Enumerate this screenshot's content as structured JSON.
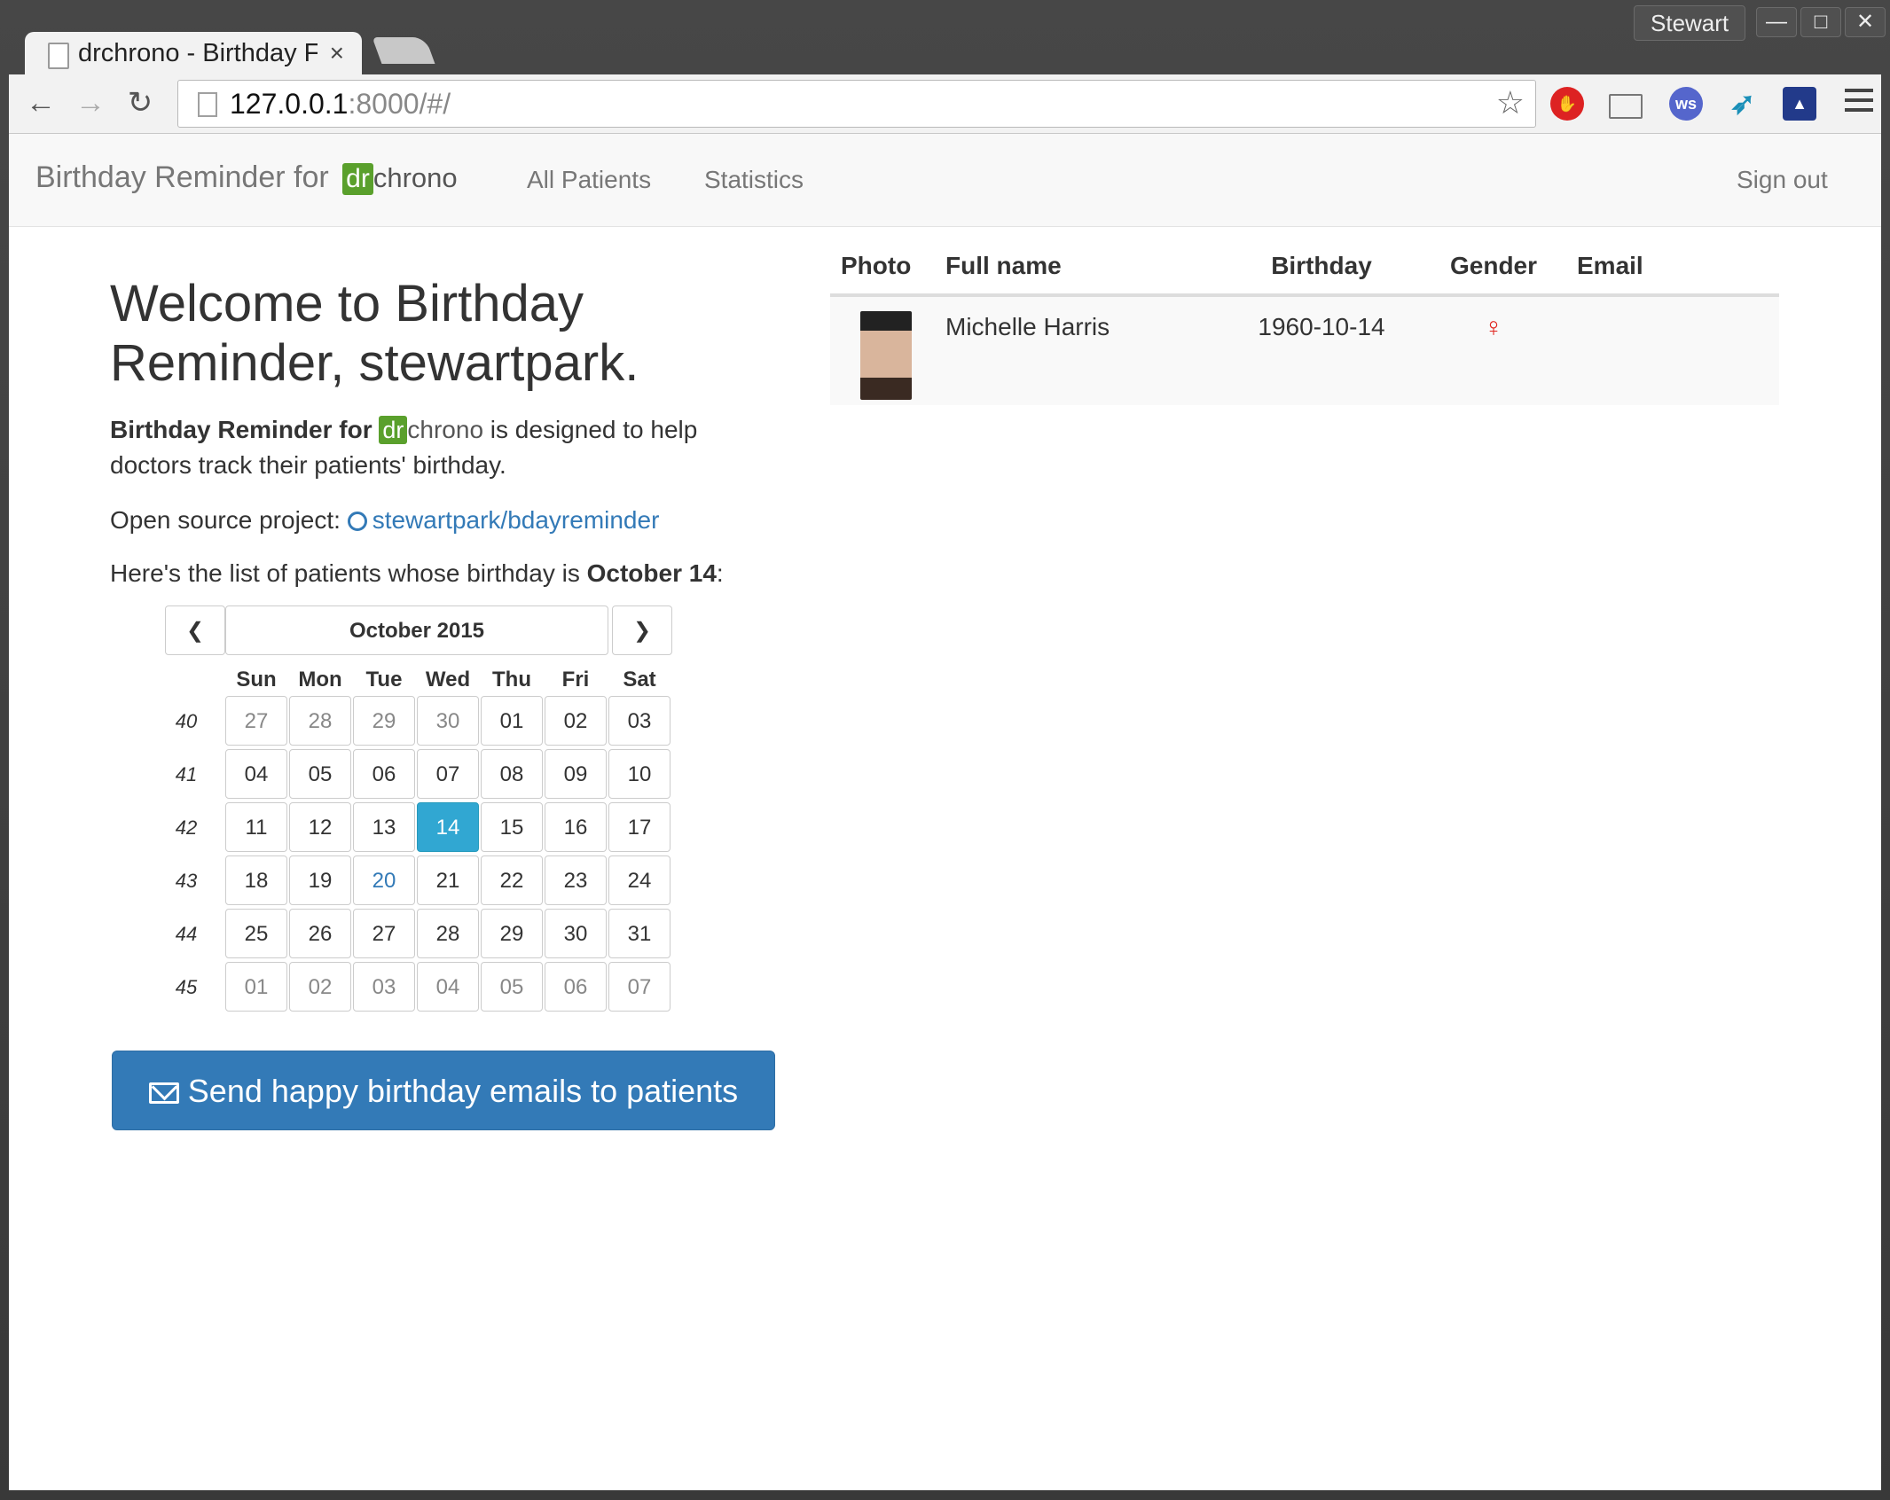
{
  "browser": {
    "tab_title": "drchrono - Birthday F",
    "tab_close": "×",
    "url_host": "127.0.0.1",
    "url_rest": ":8000/#/",
    "profile": "Stewart",
    "extensions": [
      "adblock-icon",
      "cast-icon",
      "ws-icon",
      "bird-icon",
      "stats-icon"
    ]
  },
  "navbar": {
    "brand_text": "Birthday Reminder for",
    "brand_dr": "dr",
    "brand_chrono": "chrono",
    "links": [
      "All Patients",
      "Statistics"
    ],
    "sign_out": "Sign out"
  },
  "main": {
    "welcome": "Welcome to Birthday Reminder, stewartpark.",
    "intro_bold": "Birthday Reminder for",
    "intro_dr": "dr",
    "intro_chrono": "chrono",
    "intro_rest": " is designed to help doctors track their patients' birthday.",
    "oss_label": "Open source project: ",
    "oss_link": "stewartpark/bdayreminder",
    "list_prefix": "Here's the list of patients whose birthday is ",
    "list_date": "October 14",
    "list_suffix": ":",
    "send_button": "Send happy birthday emails to patients"
  },
  "calendar": {
    "title": "October 2015",
    "weekdays": [
      "Sun",
      "Mon",
      "Tue",
      "Wed",
      "Thu",
      "Fri",
      "Sat"
    ],
    "weeks": [
      {
        "num": "40",
        "days": [
          "27",
          "28",
          "29",
          "30",
          "01",
          "02",
          "03"
        ]
      },
      {
        "num": "41",
        "days": [
          "04",
          "05",
          "06",
          "07",
          "08",
          "09",
          "10"
        ]
      },
      {
        "num": "42",
        "days": [
          "11",
          "12",
          "13",
          "14",
          "15",
          "16",
          "17"
        ]
      },
      {
        "num": "43",
        "days": [
          "18",
          "19",
          "20",
          "21",
          "22",
          "23",
          "24"
        ]
      },
      {
        "num": "44",
        "days": [
          "25",
          "26",
          "27",
          "28",
          "29",
          "30",
          "31"
        ]
      },
      {
        "num": "45",
        "days": [
          "01",
          "02",
          "03",
          "04",
          "05",
          "06",
          "07"
        ]
      }
    ],
    "selected": "14",
    "today": "20"
  },
  "table": {
    "headers": [
      "Photo",
      "Full name",
      "Birthday",
      "Gender",
      "Email"
    ],
    "rows": [
      {
        "name": "Michelle Harris",
        "birthday": "1960-10-14",
        "gender": "female-icon",
        "email": ""
      }
    ]
  }
}
